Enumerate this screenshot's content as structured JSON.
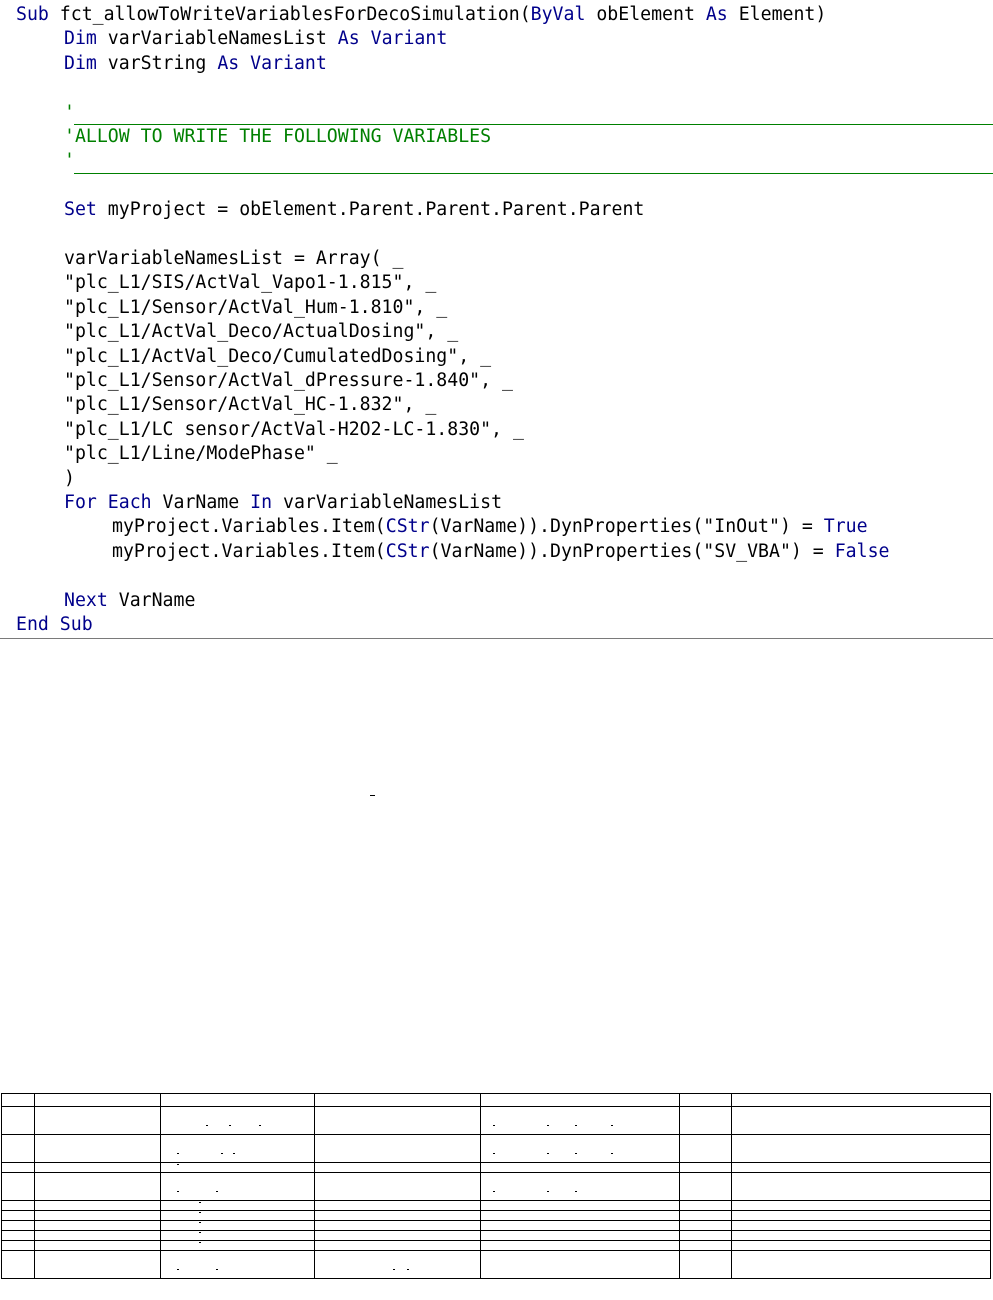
{
  "code_lines": [
    {
      "indent": 0,
      "tokens": [
        {
          "k": "kw",
          "t": "Sub"
        },
        {
          "k": "tx",
          "t": " fct_allowToWriteVariablesForDecoSimulation("
        },
        {
          "k": "kw",
          "t": "ByVal"
        },
        {
          "k": "tx",
          "t": " obElement "
        },
        {
          "k": "kw",
          "t": "As"
        },
        {
          "k": "tx",
          "t": " Element)"
        }
      ]
    },
    {
      "indent": 1,
      "tokens": [
        {
          "k": "kw",
          "t": "Dim"
        },
        {
          "k": "tx",
          "t": " varVariableNamesList "
        },
        {
          "k": "kw",
          "t": "As"
        },
        {
          "k": "tx",
          "t": " "
        },
        {
          "k": "kw",
          "t": "Variant"
        }
      ]
    },
    {
      "indent": 1,
      "tokens": [
        {
          "k": "kw",
          "t": "Dim"
        },
        {
          "k": "tx",
          "t": " varString "
        },
        {
          "k": "kw",
          "t": "As"
        },
        {
          "k": "tx",
          "t": " "
        },
        {
          "k": "kw",
          "t": "Variant"
        }
      ]
    },
    {
      "indent": 0,
      "tokens": []
    },
    {
      "indent": 1,
      "tokens": [
        {
          "k": "cm",
          "t": "'"
        }
      ]
    },
    {
      "indent": 1,
      "tokens": [
        {
          "k": "cm",
          "t": "'ALLOW TO WRITE THE FOLLOWING VARIABLES"
        }
      ]
    },
    {
      "indent": 1,
      "tokens": [
        {
          "k": "cm",
          "t": "'"
        }
      ]
    },
    {
      "indent": 0,
      "tokens": []
    },
    {
      "indent": 1,
      "tokens": [
        {
          "k": "kw",
          "t": "Set"
        },
        {
          "k": "tx",
          "t": " myProject = obElement.Parent.Parent.Parent.Parent"
        }
      ]
    },
    {
      "indent": 0,
      "tokens": []
    },
    {
      "indent": 1,
      "tokens": [
        {
          "k": "tx",
          "t": "varVariableNamesList = Array( _"
        }
      ]
    },
    {
      "indent": 1,
      "tokens": [
        {
          "k": "tx",
          "t": "\"plc_L1/SIS/ActVal_Vapo1-1.815\", _"
        }
      ]
    },
    {
      "indent": 1,
      "tokens": [
        {
          "k": "tx",
          "t": "\"plc_L1/Sensor/ActVal_Hum-1.810\", _"
        }
      ]
    },
    {
      "indent": 1,
      "tokens": [
        {
          "k": "tx",
          "t": "\"plc_L1/ActVal_Deco/ActualDosing\", _"
        }
      ]
    },
    {
      "indent": 1,
      "tokens": [
        {
          "k": "tx",
          "t": "\"plc_L1/ActVal_Deco/CumulatedDosing\", _"
        }
      ]
    },
    {
      "indent": 1,
      "tokens": [
        {
          "k": "tx",
          "t": "\"plc_L1/Sensor/ActVal_dPressure-1.840\", _"
        }
      ]
    },
    {
      "indent": 1,
      "tokens": [
        {
          "k": "tx",
          "t": "\"plc_L1/Sensor/ActVal_HC-1.832\", _"
        }
      ]
    },
    {
      "indent": 1,
      "tokens": [
        {
          "k": "tx",
          "t": "\"plc_L1/LC sensor/ActVal-H2O2-LC-1.830\", _"
        }
      ]
    },
    {
      "indent": 1,
      "tokens": [
        {
          "k": "tx",
          "t": "\"plc_L1/Line/ModePhase\" _"
        }
      ]
    },
    {
      "indent": 1,
      "tokens": [
        {
          "k": "tx",
          "t": ")"
        }
      ]
    },
    {
      "indent": 1,
      "tokens": [
        {
          "k": "kw",
          "t": "For Each"
        },
        {
          "k": "tx",
          "t": " VarName "
        },
        {
          "k": "kw",
          "t": "In"
        },
        {
          "k": "tx",
          "t": " varVariableNamesList"
        }
      ]
    },
    {
      "indent": 2,
      "tokens": [
        {
          "k": "tx",
          "t": "myProject.Variables.Item("
        },
        {
          "k": "kw",
          "t": "CStr"
        },
        {
          "k": "tx",
          "t": "(VarName)).DynProperties(\"InOut\") = "
        },
        {
          "k": "kw",
          "t": "True"
        }
      ]
    },
    {
      "indent": 2,
      "tokens": [
        {
          "k": "tx",
          "t": "myProject.Variables.Item("
        },
        {
          "k": "kw",
          "t": "CStr"
        },
        {
          "k": "tx",
          "t": "(VarName)).DynProperties(\"SV_VBA\") = "
        },
        {
          "k": "kw",
          "t": "False"
        }
      ]
    },
    {
      "indent": 0,
      "tokens": []
    },
    {
      "indent": 1,
      "tokens": [
        {
          "k": "kw",
          "t": "Next"
        },
        {
          "k": "tx",
          "t": " VarName"
        }
      ]
    },
    {
      "indent": 0,
      "tokens": [
        {
          "k": "kw",
          "t": "End Sub"
        }
      ]
    }
  ],
  "colors": {
    "keyword": "#00008b",
    "comment": "#008000",
    "text": "#000000"
  },
  "table": {
    "column_widths": [
      33,
      126,
      154,
      166,
      199,
      52,
      259
    ],
    "row_heights": [
      13,
      28,
      28,
      10,
      28,
      10,
      10,
      10,
      10,
      10,
      28
    ]
  }
}
